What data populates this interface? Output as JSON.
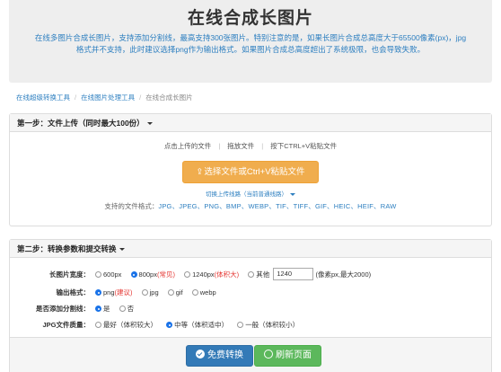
{
  "hero": {
    "title": "在线合成长图片",
    "desc": "在线多图片合成长图片，支持添加分割线，最高支持300张图片。特别注意的是，如果长图片合成总高度大于65500像素(px)，jpg格式并不支持，此时建议选择png作为输出格式。如果图片合成总高度超出了系统极限，也会导致失败。"
  },
  "breadcrumb": [
    "在线超级转换工具",
    "在线图片处理工具",
    "在线合成长图片"
  ],
  "step1": {
    "title": "第一步：文件上传（同时最大100份）",
    "tabs": [
      "点击上传的文件",
      "拖放文件",
      "按下CTRL+V粘贴文件"
    ],
    "upload_button": "选择文件或Ctrl+V粘贴文件",
    "switch_label": "切换上传线路（当前普通线路）",
    "formats_label": "支持的文件格式：",
    "formats": "JPG、JPEG、PNG、BMP、WEBP、TIF、TIFF、GIF、HEIC、HEIF、RAW"
  },
  "step2": {
    "title": "第二步：转换参数和提交转换",
    "width": {
      "label": "长图片宽度：",
      "options": [
        "600px",
        "800px",
        "(常见)",
        "1240px",
        "(体积大)",
        "其他"
      ],
      "selected": "800px",
      "custom_value": "1240",
      "unit_hint": "(像素px,最大2000)"
    },
    "format": {
      "label": "输出格式：",
      "options": [
        "png",
        "(建议)",
        "jpg",
        "gif",
        "webp"
      ],
      "selected": "png"
    },
    "divider": {
      "label": "是否添加分割线：",
      "options": [
        "是",
        "否"
      ],
      "selected": "是"
    },
    "quality": {
      "label": "JPG文件质量：",
      "options": [
        "最好（体积较大）",
        "中等（体积适中）",
        "一般（体积较小）"
      ],
      "selected": "中等（体积适中）"
    },
    "convert_button": "免费转换",
    "refresh_button": "刷新页面"
  },
  "colors": {
    "link": "#2d7fc0",
    "upload": "#f0ad4e",
    "primary": "#337ab7",
    "success": "#5cb85c",
    "red": "#e53935"
  }
}
